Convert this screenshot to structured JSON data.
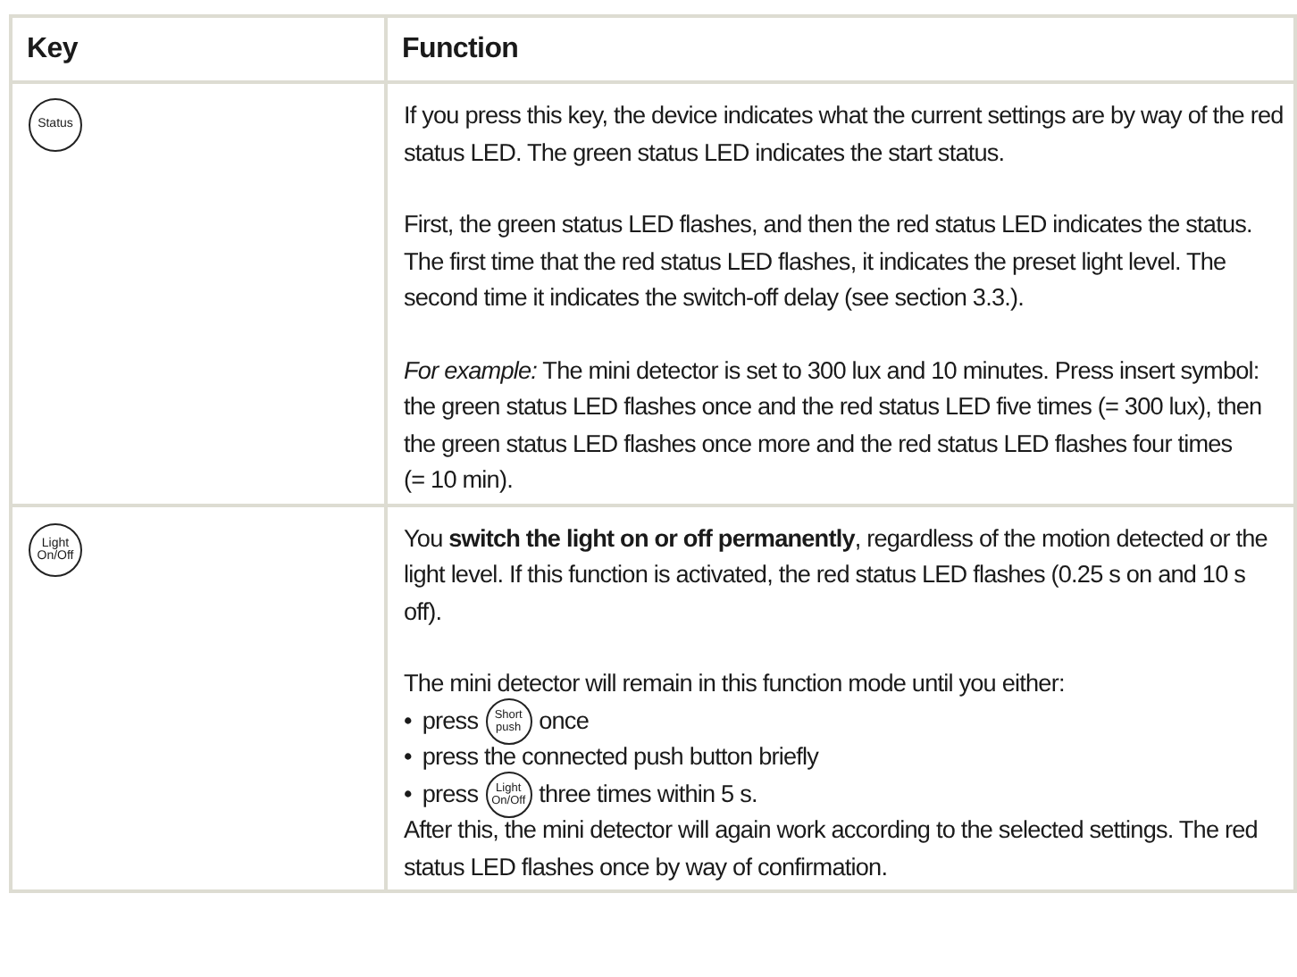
{
  "table": {
    "columns": [
      "Key",
      "Function"
    ],
    "rows": [
      {
        "key": {
          "lines": [
            "Status"
          ]
        },
        "paragraphs": [
          [
            {
              "kind": "text",
              "text": "If you press this key, the device indicates what the current settings are by way of the red status LED. The green status LED indicates the start status."
            }
          ],
          [
            {
              "kind": "text",
              "text": "First, the green status LED flashes, and then the red status LED indicates the status. The first time that the red status LED flashes, it indicates the preset light level. The second time it indicates the switch-off delay (see section 3.3.)."
            }
          ],
          [
            {
              "kind": "text",
              "text": "*For example:* The mini detector is set to 300 lux and 10 minutes. Press insert symbol: the green status LED flashes once and the red status LED five times (= 300 lux), then the green status LED flashes once more and the red status LED flashes four times"
            },
            {
              "kind": "text",
              "text": "(= 10 min)."
            }
          ]
        ]
      },
      {
        "key": {
          "lines": [
            "Light",
            "On/Off"
          ]
        },
        "paragraphs": [
          [
            {
              "kind": "text",
              "text": "You **switch the light on or off permanently**, regardless of the motion detected or the light level. If this function is activated, the red status LED flashes (0.25 s on and 10 s off)."
            }
          ],
          [
            {
              "kind": "text",
              "text": "The mini detector will remain in this function mode until you either:"
            },
            {
              "kind": "bullet",
              "marker": "•",
              "segments": [
                {
                  "kind": "text",
                  "text": "press"
                },
                {
                  "kind": "key",
                  "lines": [
                    "Short",
                    "push"
                  ]
                },
                {
                  "kind": "text",
                  "text": "once"
                }
              ]
            },
            {
              "kind": "bullet",
              "marker": "•",
              "segments": [
                {
                  "kind": "text",
                  "text": "press the connected push button briefly"
                }
              ]
            },
            {
              "kind": "bullet",
              "marker": "•",
              "segments": [
                {
                  "kind": "text",
                  "text": "press"
                },
                {
                  "kind": "key",
                  "lines": [
                    "Light",
                    "On/Off"
                  ]
                },
                {
                  "kind": "text",
                  "text": "three times within 5 s."
                }
              ]
            },
            {
              "kind": "text",
              "text": "After this, the mini detector will again work according to the selected settings. The red status LED flashes once by way of confirmation."
            }
          ]
        ]
      }
    ]
  }
}
